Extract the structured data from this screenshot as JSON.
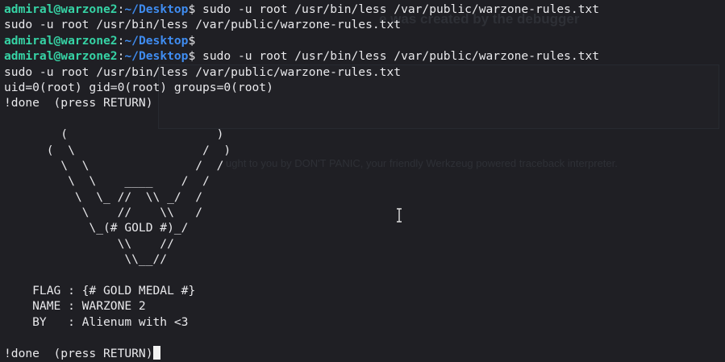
{
  "ghost": {
    "title": "e was created by the debugger",
    "line": "ught to you by DON'T PANIC, your friendly Werkzeug powered traceback interpreter."
  },
  "prompt": {
    "user_host": "admiral@warzone2",
    "separator": ":",
    "path": "~/Desktop",
    "symbol": "$"
  },
  "terminal": {
    "cmd1": " sudo -u root /usr/bin/less /var/public/warzone-rules.txt",
    "echo1": "sudo -u root /usr/bin/less /var/public/warzone-rules.txt",
    "cmd3": " sudo -u root /usr/bin/less /var/public/warzone-rules.txt",
    "echo2": "sudo -u root /usr/bin/less /var/public/warzone-rules.txt",
    "id_output": "uid=0(root) gid=0(root) groups=0(root)",
    "done1": "!done  (press RETURN)",
    "art": [
      "        (                     )",
      "      (  \\                  /  )",
      "        \\  \\               /  /",
      "         \\  \\    ____    /  /",
      "          \\  \\_ //  \\\\ _/  /",
      "           \\    //    \\\\   /",
      "            \\_(# GOLD #)_/",
      "                \\\\    //",
      "                 \\\\__//"
    ],
    "flag_line": "    FLAG : {# GOLD MEDAL #}",
    "name_line": "    NAME : WARZONE 2",
    "by_line": "    BY   : Alienum with <3",
    "done2": "!done  (press RETURN)"
  }
}
